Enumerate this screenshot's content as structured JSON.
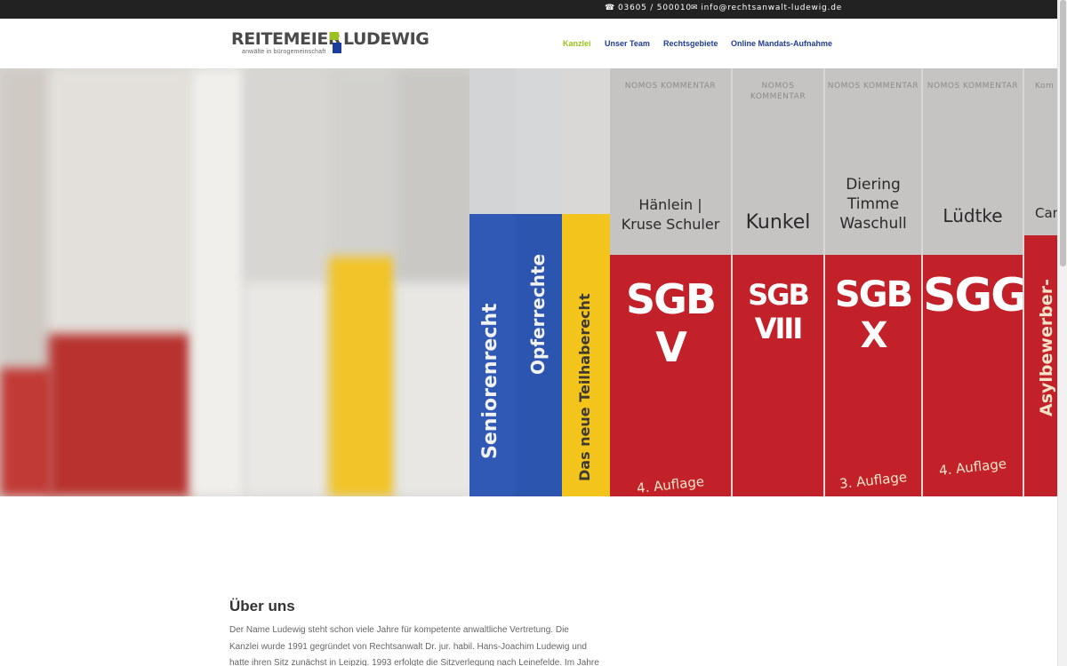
{
  "topbar": {
    "phone": "03605 / 500010",
    "email": "info@rechtsanwalt-ludewig.de"
  },
  "logo": {
    "name_left": "REITEMEIER",
    "name_right": "LUDEWIG",
    "tagline": "anwälte in bürogemeinschaft"
  },
  "nav": {
    "items": [
      "Kanzlei",
      "Unser Team",
      "Rechtsgebiete",
      "Online Mandats-Aufnahme"
    ],
    "active": "Kanzlei"
  },
  "hero": {
    "books": [
      {
        "publisher": "NOMOS KOMMENTAR",
        "authors": "Hänlein | Kruse Schuler",
        "title": "SGB V",
        "edition": "4. Auflage"
      },
      {
        "publisher": "NOMOS KOMMENTAR",
        "authors": "Kunkel",
        "title": "SGB VIII",
        "edition": ""
      },
      {
        "publisher": "NOMOS KOMMENTAR",
        "authors": "Diering Timme Waschull",
        "title": "SGB X",
        "edition": "3. Auflage"
      },
      {
        "publisher": "NOMOS KOMMENTAR",
        "authors": "Lüdtke",
        "title": "SGG",
        "edition": "4. Auflage"
      }
    ],
    "spines": [
      "Seniorenrecht",
      "Opferrechte",
      "Das neue Teilhaberecht",
      "Asylbewerber-"
    ],
    "edge_book": {
      "authors": "Can",
      "publisher": "Kom"
    }
  },
  "content": {
    "title": "Über uns",
    "lines": [
      "Der Name Ludewig steht schon viele Jahre für kompetente anwaltliche Vertretung. Die",
      "Kanzlei wurde 1991 gegründet von Rechtsanwalt Dr. jur. habil. Hans-Joachim Ludewig und",
      "hatte ihren Sitz zunächst in Leipzig. 1993 erfolgte die Sitzverlegung nach Leinefelde. Im Jahre"
    ]
  },
  "colors": {
    "accent_green": "#9bc31c",
    "nav_blue": "#1f3c95",
    "topbar_bg": "#222222",
    "book_red": "#c2212a"
  }
}
